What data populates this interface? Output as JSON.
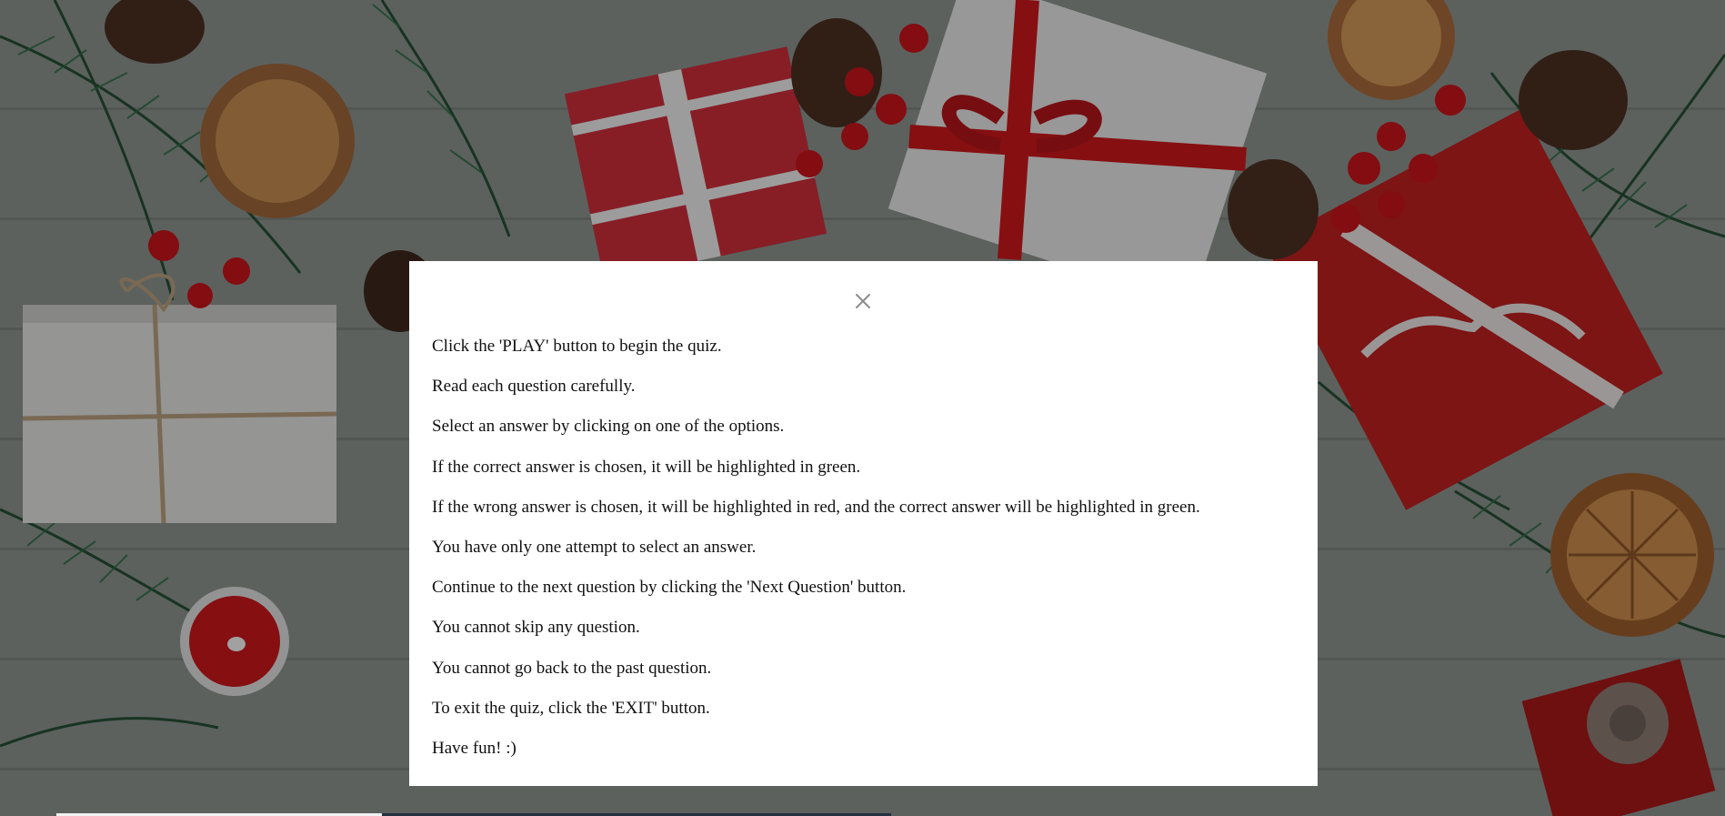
{
  "modal": {
    "close_label": "×",
    "rules": [
      "Click the 'PLAY' button to begin the quiz.",
      "Read each question carefully.",
      "Select an answer by clicking on one of the options.",
      "If the correct answer is chosen, it will be highlighted in green.",
      "If the wrong answer is chosen, it will be highlighted in red, and the correct answer will be highlighted in green.",
      "You have only one attempt to select an answer.",
      "Continue to the next question by clicking the 'Next Question' button.",
      "You cannot skip any question.",
      "You cannot go back to the past question.",
      "To exit the quiz, click the 'EXIT' button.",
      "Have fun! :)"
    ]
  },
  "colors": {
    "modal_background": "#ffffff",
    "text": "#111111",
    "close_icon": "#8c8c8c",
    "page_overlay": "rgba(0,0,0,0.33)"
  },
  "icons": {
    "close": "close-icon"
  }
}
